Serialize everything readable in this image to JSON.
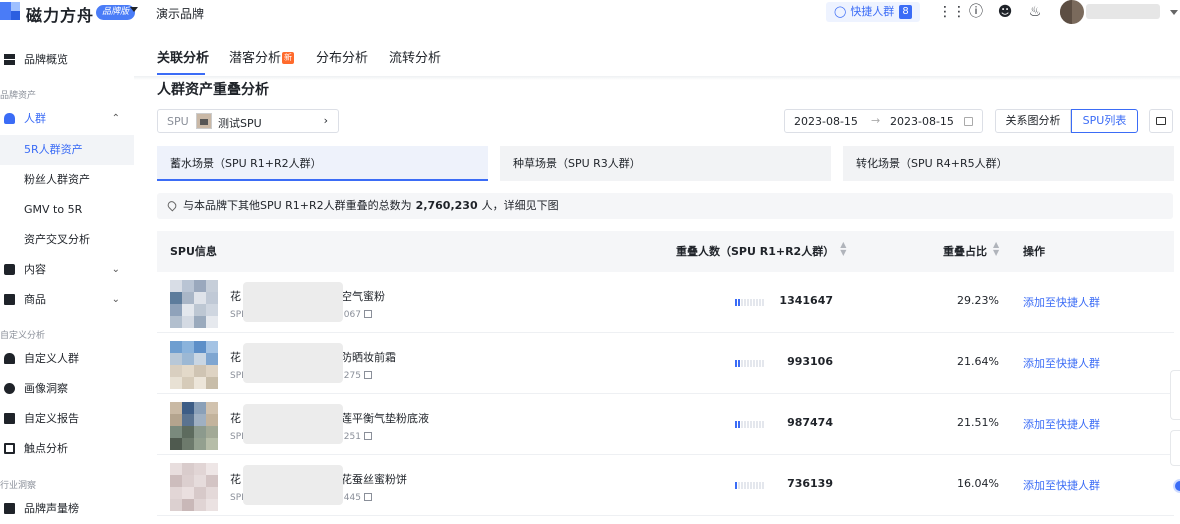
{
  "header": {
    "logo_text": "磁力方舟",
    "edition_badge": "品牌版",
    "brand": "演示品牌",
    "quick_btn_label": "快捷人群",
    "quick_btn_count": "8"
  },
  "sidebar": {
    "items": [
      {
        "label": "品牌概览",
        "icon": "grid-icon"
      },
      {
        "label": "品牌资产",
        "type": "section"
      },
      {
        "label": "人群",
        "icon": "users-icon"
      },
      {
        "label": "5R人群资产"
      },
      {
        "label": "粉丝人群资产"
      },
      {
        "label": "GMV to 5R"
      },
      {
        "label": "资产交叉分析"
      },
      {
        "label": "内容",
        "icon": "content-icon"
      },
      {
        "label": "商品",
        "icon": "goods-icon"
      },
      {
        "label": "自定义分析",
        "type": "section"
      },
      {
        "label": "自定义人群",
        "icon": "custom-user-icon"
      },
      {
        "label": "画像洞察",
        "icon": "portrait-icon"
      },
      {
        "label": "自定义报告",
        "icon": "report-icon"
      },
      {
        "label": "触点分析",
        "icon": "touchpoint-icon"
      },
      {
        "label": "行业洞察",
        "type": "section"
      },
      {
        "label": "品牌声量榜",
        "icon": "rank-icon"
      }
    ]
  },
  "tabs": [
    {
      "label": "关联分析",
      "active": true
    },
    {
      "label": "潜客分析",
      "badge": "新"
    },
    {
      "label": "分布分析"
    },
    {
      "label": "流转分析"
    }
  ],
  "section_title": "人群资产重叠分析",
  "spu_filter": {
    "label": "SPU",
    "value": "测试SPU"
  },
  "date_range": {
    "start": "2023-08-15",
    "end": "2023-08-15"
  },
  "view_toggle": {
    "relation": "关系图分析",
    "spu_list": "SPU列表"
  },
  "scenes": [
    {
      "label": "蓄水场景（SPU R1+R2人群）",
      "active": true
    },
    {
      "label": "种草场景（SPU R3人群）"
    },
    {
      "label": "转化场景（SPU R4+R5人群）"
    }
  ],
  "notice": {
    "prefix": "与本品牌下其他SPU R1+R2人群重叠的总数为",
    "value": "2,760,230",
    "suffix": "人，详细见下图"
  },
  "table": {
    "headers": {
      "spu": "SPU信息",
      "overlap_count": "重叠人数（SPU R1+R2人群）",
      "overlap_ratio": "重叠占比",
      "action": "操作"
    },
    "rows": [
      {
        "name_start": "花",
        "name_end": "空气蜜粉",
        "id_prefix": "SPI",
        "id_suffix": "067",
        "bar_level": 0.2923,
        "count": "1341647",
        "ratio": "29.23%",
        "action": "添加至快捷人群"
      },
      {
        "name_start": "花",
        "name_end": "防晒妆前霜",
        "id_prefix": "SPI",
        "id_suffix": "275",
        "bar_level": 0.2164,
        "count": "993106",
        "ratio": "21.64%",
        "action": "添加至快捷人群"
      },
      {
        "name_start": "花",
        "name_end": "莲平衡气垫粉底液",
        "id_prefix": "SPI",
        "id_suffix": "251",
        "bar_level": 0.2151,
        "count": "987474",
        "ratio": "21.51%",
        "action": "添加至快捷人群"
      },
      {
        "name_start": "花",
        "name_end": "花蚕丝蜜粉饼",
        "id_prefix": "SPI",
        "id_suffix": "445",
        "bar_level": 0.1604,
        "count": "736139",
        "ratio": "16.04%",
        "action": "添加至快捷人群"
      }
    ]
  },
  "colors": {
    "accent": "#3b6cf6",
    "new_badge": "#ff6a2c",
    "scene_active_bg": "#eef2fb"
  }
}
